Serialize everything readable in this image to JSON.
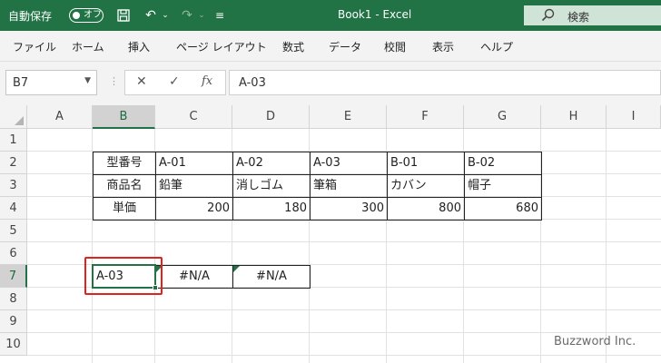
{
  "titlebar": {
    "autosave_label": "自動保存",
    "autosave_state": "オフ",
    "doc_title": "Book1  -  Excel",
    "search_label": "検索"
  },
  "ribbon": {
    "tabs": [
      "ファイル",
      "ホーム",
      "挿入",
      "ページ レイアウト",
      "数式",
      "データ",
      "校閲",
      "表示",
      "ヘルプ"
    ]
  },
  "formula_bar": {
    "name_box": "B7",
    "formula": "A-03",
    "fx_label": "fx"
  },
  "sheet": {
    "columns": [
      "A",
      "B",
      "C",
      "D",
      "E",
      "F",
      "G",
      "H",
      "I"
    ],
    "rows": [
      "1",
      "2",
      "3",
      "4",
      "5",
      "6",
      "7",
      "8",
      "9",
      "10"
    ],
    "selected_column": "B",
    "selected_row": "7",
    "table": {
      "row2": [
        "型番号",
        "A-01",
        "A-02",
        "A-03",
        "B-01",
        "B-02"
      ],
      "row3": [
        "商品名",
        "鉛筆",
        "消しゴム",
        "筆箱",
        "カバン",
        "帽子"
      ],
      "row4": [
        "単価",
        "200",
        "180",
        "300",
        "800",
        "680"
      ]
    },
    "row7": {
      "b7": "A-03",
      "c7": "#N/A",
      "d7": "#N/A"
    }
  },
  "watermark": "Buzzword Inc.",
  "colors": {
    "excel_green": "#217346",
    "highlight_red": "#e0231e"
  }
}
